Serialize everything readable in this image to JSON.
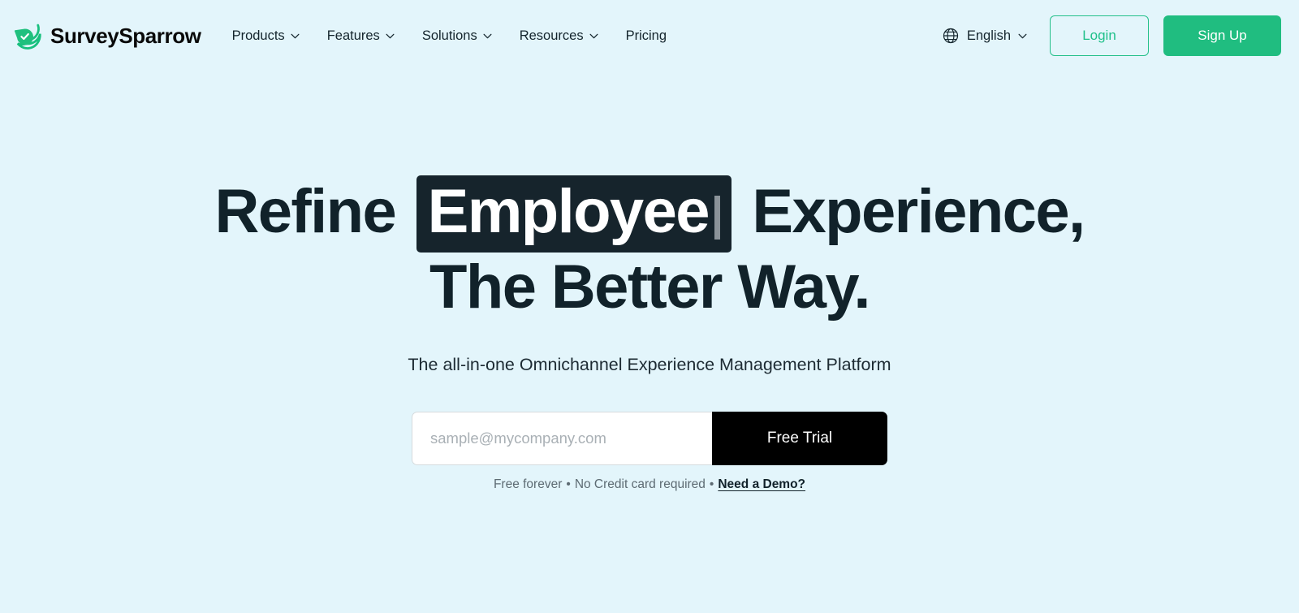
{
  "theme": {
    "page_background": "#e3f5fb",
    "accent_green": "#20bd80",
    "headline_color": "#11222a",
    "chip_background": "#16242c",
    "cta_background": "#000000"
  },
  "header": {
    "brand": {
      "name": "SurveySparrow",
      "logo_icon": "surveysparrow-bird-check-logo"
    },
    "nav": [
      {
        "label": "Products",
        "has_dropdown": true
      },
      {
        "label": "Features",
        "has_dropdown": true
      },
      {
        "label": "Solutions",
        "has_dropdown": true
      },
      {
        "label": "Resources",
        "has_dropdown": true
      },
      {
        "label": "Pricing",
        "has_dropdown": false
      }
    ],
    "language": {
      "icon": "globe-icon",
      "label": "English",
      "has_dropdown": true
    },
    "login_label": "Login",
    "signup_label": "Sign Up"
  },
  "hero": {
    "headline": {
      "line1_prefix": "Refine",
      "line1_highlight": "Employee",
      "line1_suffix": "Experience,",
      "line2": "The Better Way."
    },
    "subheadline": "The all-in-one Omnichannel Experience Management Platform",
    "form": {
      "email_placeholder": "sample@mycompany.com",
      "email_value": "",
      "submit_label": "Free Trial"
    },
    "fineprint": {
      "item1": "Free forever",
      "separator": "•",
      "item2": "No Credit card required",
      "demo_link": "Need a Demo?"
    }
  }
}
